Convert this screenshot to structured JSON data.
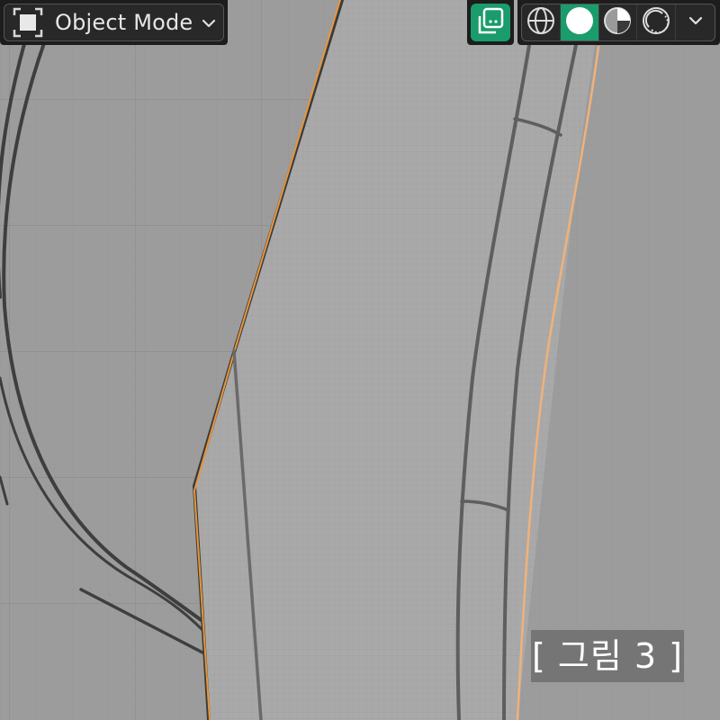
{
  "header": {
    "mode_label": "Object Mode",
    "mode_icon": "object-mode-icon",
    "mode_dropdown_icon": "chevron-down-icon",
    "overlay_icon": "overlays-icon",
    "shading_buttons": [
      {
        "name": "wireframe",
        "icon": "wireframe-shading-icon",
        "active": false
      },
      {
        "name": "solid",
        "icon": "solid-shading-icon",
        "active": true
      },
      {
        "name": "material-preview",
        "icon": "material-preview-icon",
        "active": false
      },
      {
        "name": "rendered",
        "icon": "rendered-shading-icon",
        "active": false
      }
    ],
    "shading_dropdown_icon": "chevron-down-icon"
  },
  "caption": "[ 그림 3 ]",
  "colors": {
    "accent": "#1a9c6c",
    "header_bg": "#1d1d1d",
    "selection_outline": "#e8963c",
    "viewport_bg": "#9a9a9a"
  }
}
